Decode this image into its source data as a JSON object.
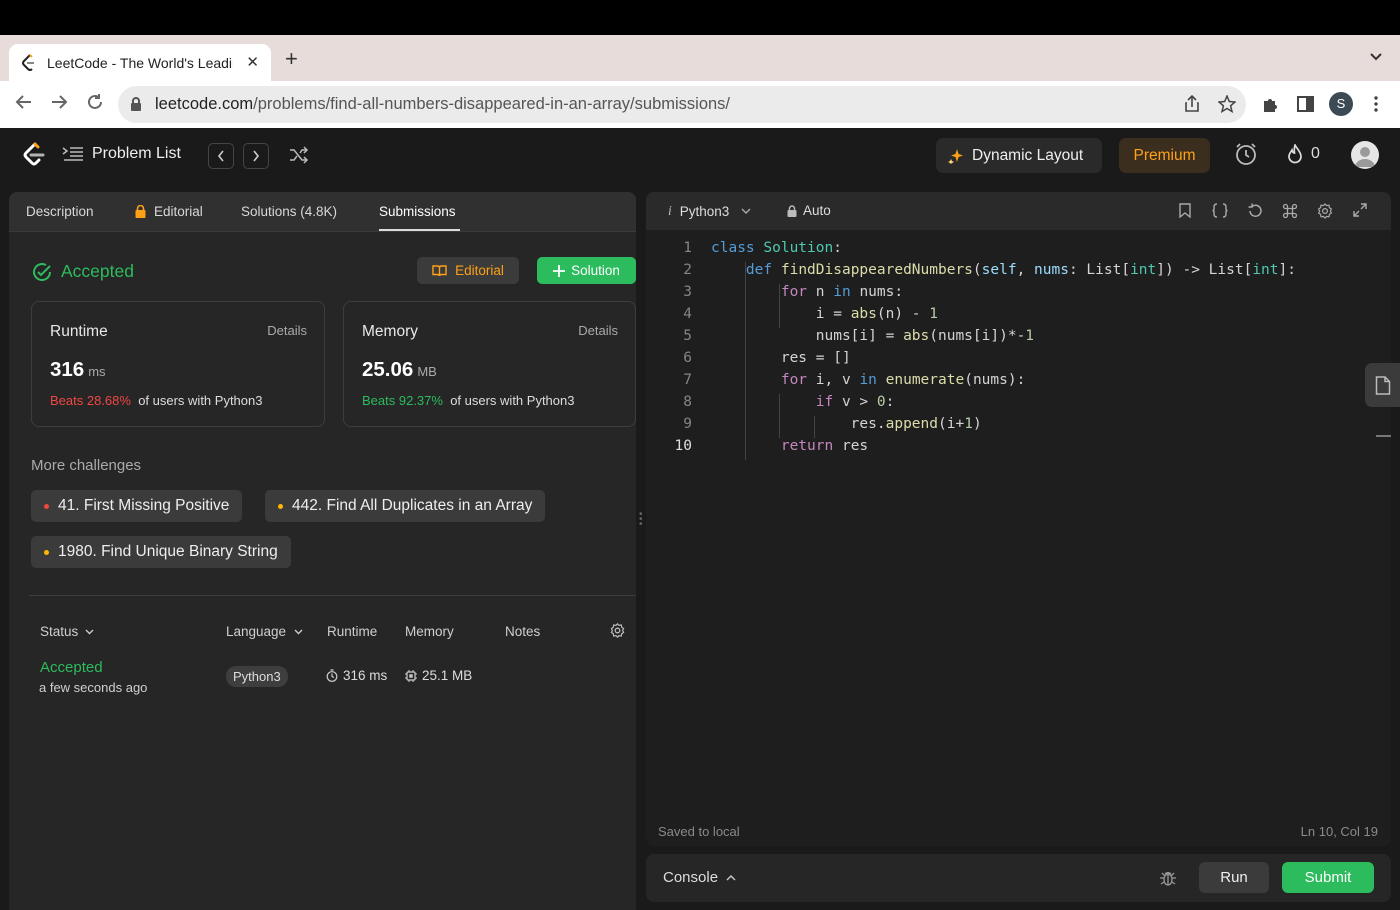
{
  "browser": {
    "tab_title": "LeetCode - The World's Leading",
    "url_host": "leetcode.com",
    "url_path": "/problems/find-all-numbers-disappeared-in-an-array/submissions/",
    "profile_initial": "S"
  },
  "nav": {
    "problem_list": "Problem List",
    "dynamic_layout": "Dynamic Layout",
    "premium": "Premium",
    "streak_count": "0"
  },
  "left_tabs": {
    "description": "Description",
    "editorial": "Editorial",
    "solutions": "Solutions (4.8K)",
    "submissions": "Submissions"
  },
  "result": {
    "status": "Accepted",
    "editorial_btn": "Editorial",
    "solution_btn": "Solution",
    "runtime": {
      "label": "Runtime",
      "details": "Details",
      "value": "316",
      "unit": "ms",
      "beats": "Beats 28.68%",
      "beats_suffix": "of users with Python3"
    },
    "memory": {
      "label": "Memory",
      "details": "Details",
      "value": "25.06",
      "unit": "MB",
      "beats": "Beats 92.37%",
      "beats_suffix": "of users with Python3"
    }
  },
  "challenges": {
    "title": "More challenges",
    "items": [
      {
        "label": "41. First Missing Positive",
        "color": "#ef4743"
      },
      {
        "label": "442. Find All Duplicates in an Array",
        "color": "#ffb800"
      },
      {
        "label": "1980. Find Unique Binary String",
        "color": "#ffb800"
      }
    ]
  },
  "table": {
    "headers": {
      "status": "Status",
      "language": "Language",
      "runtime": "Runtime",
      "memory": "Memory",
      "notes": "Notes"
    },
    "rows": [
      {
        "status": "Accepted",
        "time": "a few seconds ago",
        "language": "Python3",
        "runtime": "316 ms",
        "memory": "25.1 MB"
      }
    ]
  },
  "editor": {
    "language": "Python3",
    "mode": "Auto",
    "line_numbers": [
      "1",
      "2",
      "3",
      "4",
      "5",
      "6",
      "7",
      "8",
      "9",
      "10"
    ],
    "saved": "Saved to local",
    "cursor": "Ln 10, Col 19"
  },
  "console": {
    "label": "Console",
    "run": "Run",
    "submit": "Submit"
  },
  "colors": {
    "accent_green": "#2cbb5d",
    "premium_orange": "#ffa116",
    "beats_red": "#ef4743"
  }
}
